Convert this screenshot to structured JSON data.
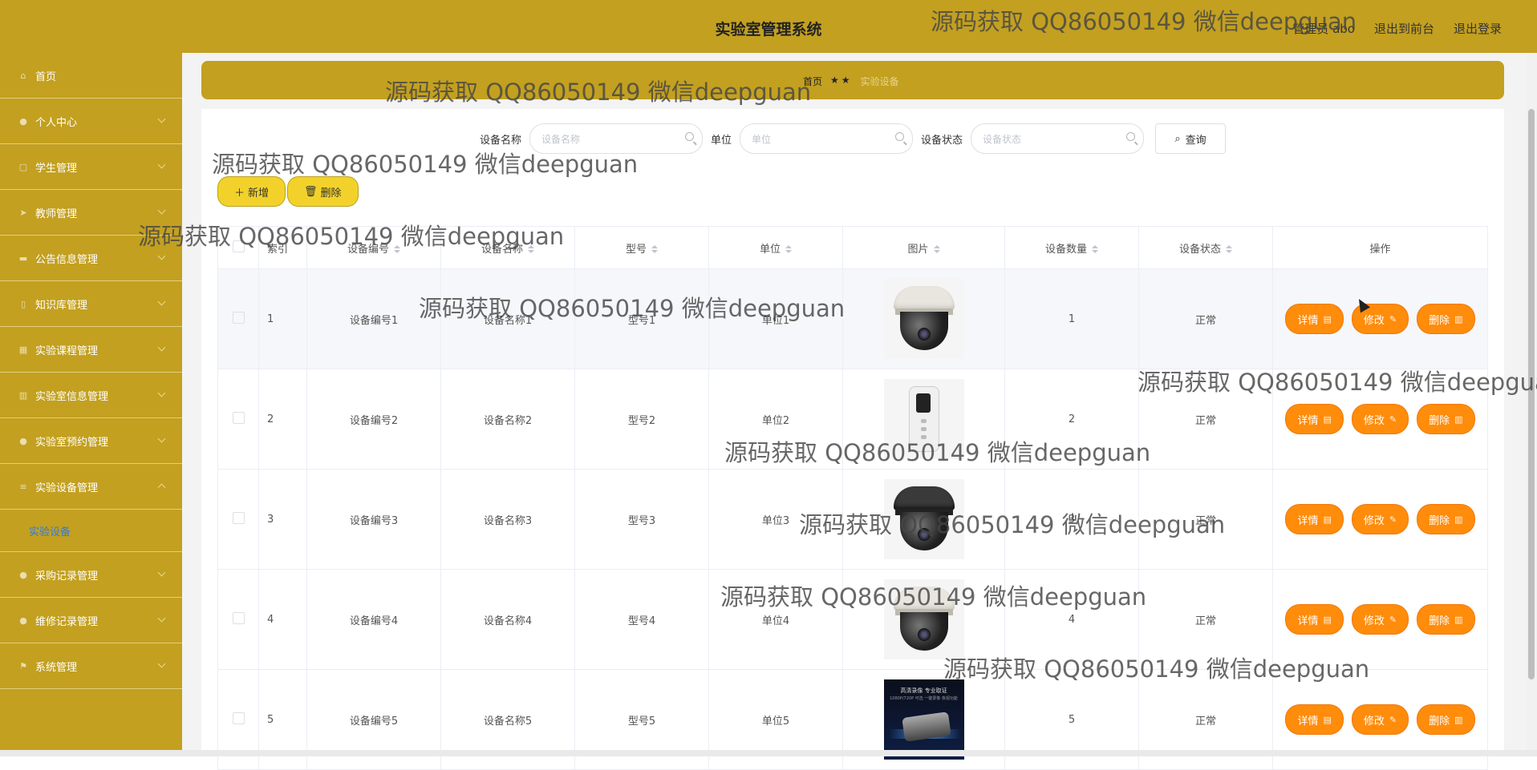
{
  "header": {
    "title": "实验室管理系统",
    "user": "管理员 abo",
    "to_front": "退出到前台",
    "logout": "退出登录"
  },
  "sidebar": {
    "items": [
      {
        "label": "首页",
        "icon": "home-icon"
      },
      {
        "label": "个人中心",
        "icon": "user-icon"
      },
      {
        "label": "学生管理",
        "icon": "list-icon"
      },
      {
        "label": "教师管理",
        "icon": "send-icon"
      },
      {
        "label": "公告信息管理",
        "icon": "message-icon"
      },
      {
        "label": "知识库管理",
        "icon": "book-icon"
      },
      {
        "label": "实验课程管理",
        "icon": "grid-icon"
      },
      {
        "label": "实验室信息管理",
        "icon": "chart-icon"
      },
      {
        "label": "实验室预约管理",
        "icon": "user-icon"
      },
      {
        "label": "实验设备管理",
        "icon": "stack-icon"
      },
      {
        "label": "采购记录管理",
        "icon": "dot-icon"
      },
      {
        "label": "维修记录管理",
        "icon": "user-icon"
      },
      {
        "label": "系统管理",
        "icon": "flag-icon"
      }
    ],
    "active_sub": "实验设备"
  },
  "breadcrumb": {
    "home": "首页",
    "sep": "★★",
    "current": "实验设备"
  },
  "search": {
    "name_label": "设备名称",
    "name_placeholder": "设备名称",
    "unit_label": "单位",
    "unit_placeholder": "单位",
    "status_label": "设备状态",
    "status_placeholder": "设备状态",
    "query_label": "查询"
  },
  "actions": {
    "add_label": "新增",
    "delete_label": "删除"
  },
  "table": {
    "headers": [
      "索引",
      "设备编号",
      "设备名称",
      "型号",
      "单位",
      "图片",
      "设备数量",
      "设备状态",
      "操作"
    ],
    "rows": [
      {
        "index": "1",
        "code": "设备编号1",
        "name": "设备名称1",
        "model": "型号1",
        "unit": "单位1",
        "image": "dome-camera-white",
        "qty": "1",
        "status": "正常"
      },
      {
        "index": "2",
        "code": "设备编号2",
        "name": "设备名称2",
        "model": "型号2",
        "unit": "单位2",
        "image": "remote-device",
        "qty": "2",
        "status": "正常"
      },
      {
        "index": "3",
        "code": "设备编号3",
        "name": "设备名称3",
        "model": "型号3",
        "unit": "单位3",
        "image": "dome-camera-dark",
        "qty": "3",
        "status": "正常"
      },
      {
        "index": "4",
        "code": "设备编号4",
        "name": "设备名称4",
        "model": "型号4",
        "unit": "单位4",
        "image": "dome-camera-white",
        "qty": "4",
        "status": "正常"
      },
      {
        "index": "5",
        "code": "设备编号5",
        "name": "设备名称5",
        "model": "型号5",
        "unit": "单位5",
        "image": "projector-ad",
        "qty": "5",
        "status": "正常"
      }
    ],
    "op_detail": "详情",
    "op_edit": "修改",
    "op_delete": "删除"
  },
  "ad_image_text": {
    "line1": "高清录像 专业取证",
    "line2": "1080P/720P 可选 一键录像 夜视功能"
  },
  "watermark": "源码获取 QQ86050149 微信deepguan",
  "colors": {
    "gold": "#c3a020",
    "orange_button": "#ff8c0a",
    "yellow_button": "#f2d22a",
    "active_link": "#2e7be6"
  }
}
